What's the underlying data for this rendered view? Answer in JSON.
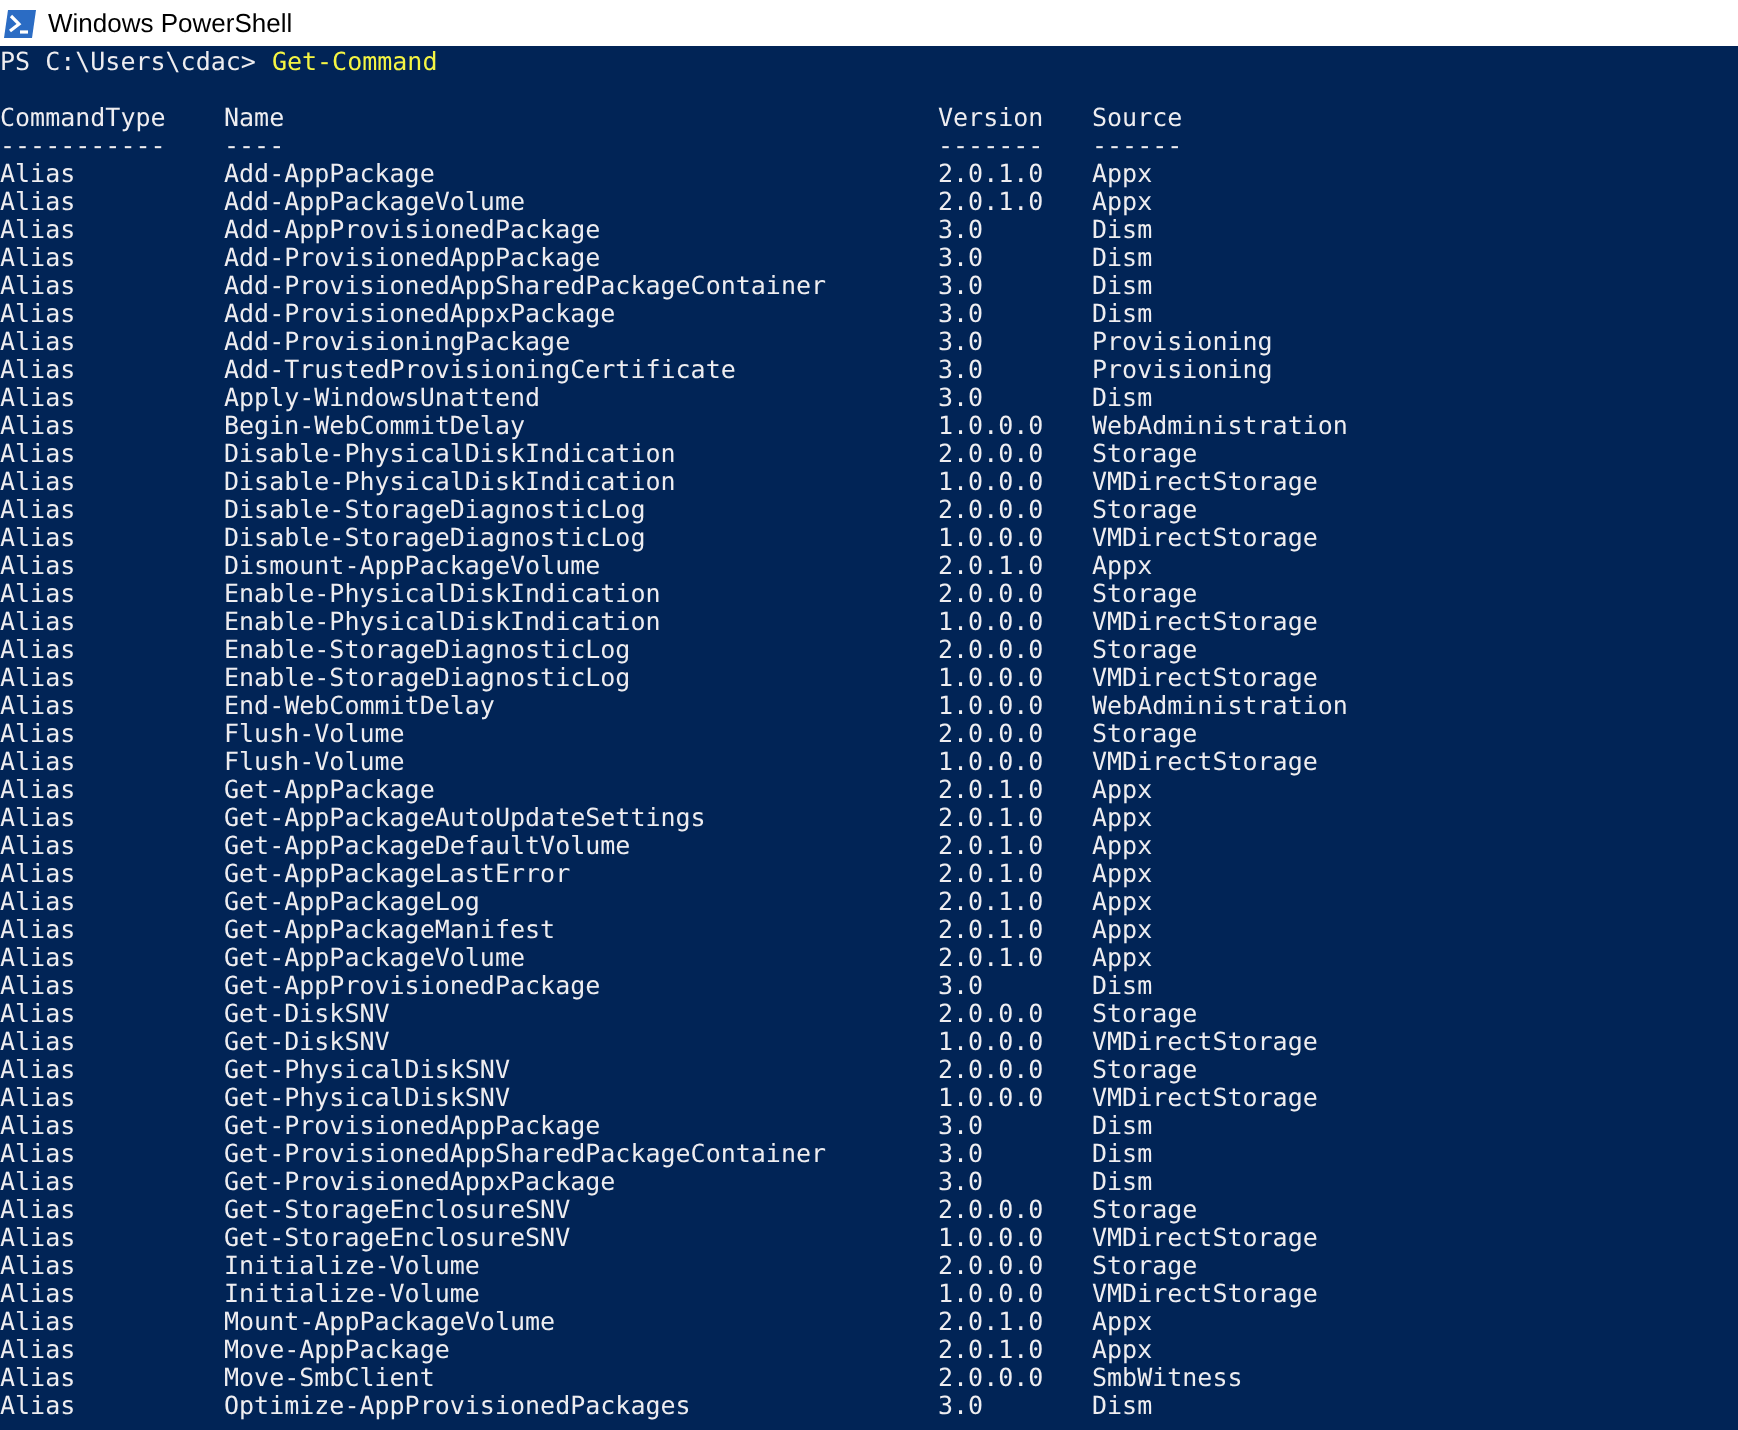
{
  "window": {
    "title": "Windows PowerShell"
  },
  "prompt": {
    "text": "PS C:\\Users\\cdac>",
    "command": "Get-Command"
  },
  "table": {
    "columns": [
      {
        "header": "CommandType",
        "underline": "-----------"
      },
      {
        "header": "Name",
        "underline": "----"
      },
      {
        "header": "Version",
        "underline": "-------"
      },
      {
        "header": "Source",
        "underline": "------"
      }
    ],
    "rows": [
      [
        "Alias",
        "Add-AppPackage",
        "2.0.1.0",
        "Appx"
      ],
      [
        "Alias",
        "Add-AppPackageVolume",
        "2.0.1.0",
        "Appx"
      ],
      [
        "Alias",
        "Add-AppProvisionedPackage",
        "3.0",
        "Dism"
      ],
      [
        "Alias",
        "Add-ProvisionedAppPackage",
        "3.0",
        "Dism"
      ],
      [
        "Alias",
        "Add-ProvisionedAppSharedPackageContainer",
        "3.0",
        "Dism"
      ],
      [
        "Alias",
        "Add-ProvisionedAppxPackage",
        "3.0",
        "Dism"
      ],
      [
        "Alias",
        "Add-ProvisioningPackage",
        "3.0",
        "Provisioning"
      ],
      [
        "Alias",
        "Add-TrustedProvisioningCertificate",
        "3.0",
        "Provisioning"
      ],
      [
        "Alias",
        "Apply-WindowsUnattend",
        "3.0",
        "Dism"
      ],
      [
        "Alias",
        "Begin-WebCommitDelay",
        "1.0.0.0",
        "WebAdministration"
      ],
      [
        "Alias",
        "Disable-PhysicalDiskIndication",
        "2.0.0.0",
        "Storage"
      ],
      [
        "Alias",
        "Disable-PhysicalDiskIndication",
        "1.0.0.0",
        "VMDirectStorage"
      ],
      [
        "Alias",
        "Disable-StorageDiagnosticLog",
        "2.0.0.0",
        "Storage"
      ],
      [
        "Alias",
        "Disable-StorageDiagnosticLog",
        "1.0.0.0",
        "VMDirectStorage"
      ],
      [
        "Alias",
        "Dismount-AppPackageVolume",
        "2.0.1.0",
        "Appx"
      ],
      [
        "Alias",
        "Enable-PhysicalDiskIndication",
        "2.0.0.0",
        "Storage"
      ],
      [
        "Alias",
        "Enable-PhysicalDiskIndication",
        "1.0.0.0",
        "VMDirectStorage"
      ],
      [
        "Alias",
        "Enable-StorageDiagnosticLog",
        "2.0.0.0",
        "Storage"
      ],
      [
        "Alias",
        "Enable-StorageDiagnosticLog",
        "1.0.0.0",
        "VMDirectStorage"
      ],
      [
        "Alias",
        "End-WebCommitDelay",
        "1.0.0.0",
        "WebAdministration"
      ],
      [
        "Alias",
        "Flush-Volume",
        "2.0.0.0",
        "Storage"
      ],
      [
        "Alias",
        "Flush-Volume",
        "1.0.0.0",
        "VMDirectStorage"
      ],
      [
        "Alias",
        "Get-AppPackage",
        "2.0.1.0",
        "Appx"
      ],
      [
        "Alias",
        "Get-AppPackageAutoUpdateSettings",
        "2.0.1.0",
        "Appx"
      ],
      [
        "Alias",
        "Get-AppPackageDefaultVolume",
        "2.0.1.0",
        "Appx"
      ],
      [
        "Alias",
        "Get-AppPackageLastError",
        "2.0.1.0",
        "Appx"
      ],
      [
        "Alias",
        "Get-AppPackageLog",
        "2.0.1.0",
        "Appx"
      ],
      [
        "Alias",
        "Get-AppPackageManifest",
        "2.0.1.0",
        "Appx"
      ],
      [
        "Alias",
        "Get-AppPackageVolume",
        "2.0.1.0",
        "Appx"
      ],
      [
        "Alias",
        "Get-AppProvisionedPackage",
        "3.0",
        "Dism"
      ],
      [
        "Alias",
        "Get-DiskSNV",
        "2.0.0.0",
        "Storage"
      ],
      [
        "Alias",
        "Get-DiskSNV",
        "1.0.0.0",
        "VMDirectStorage"
      ],
      [
        "Alias",
        "Get-PhysicalDiskSNV",
        "2.0.0.0",
        "Storage"
      ],
      [
        "Alias",
        "Get-PhysicalDiskSNV",
        "1.0.0.0",
        "VMDirectStorage"
      ],
      [
        "Alias",
        "Get-ProvisionedAppPackage",
        "3.0",
        "Dism"
      ],
      [
        "Alias",
        "Get-ProvisionedAppSharedPackageContainer",
        "3.0",
        "Dism"
      ],
      [
        "Alias",
        "Get-ProvisionedAppxPackage",
        "3.0",
        "Dism"
      ],
      [
        "Alias",
        "Get-StorageEnclosureSNV",
        "2.0.0.0",
        "Storage"
      ],
      [
        "Alias",
        "Get-StorageEnclosureSNV",
        "1.0.0.0",
        "VMDirectStorage"
      ],
      [
        "Alias",
        "Initialize-Volume",
        "2.0.0.0",
        "Storage"
      ],
      [
        "Alias",
        "Initialize-Volume",
        "1.0.0.0",
        "VMDirectStorage"
      ],
      [
        "Alias",
        "Mount-AppPackageVolume",
        "2.0.1.0",
        "Appx"
      ],
      [
        "Alias",
        "Move-AppPackage",
        "2.0.1.0",
        "Appx"
      ],
      [
        "Alias",
        "Move-SmbClient",
        "2.0.0.0",
        "SmbWitness"
      ],
      [
        "Alias",
        "Optimize-AppProvisionedPackages",
        "3.0",
        "Dism"
      ]
    ]
  }
}
